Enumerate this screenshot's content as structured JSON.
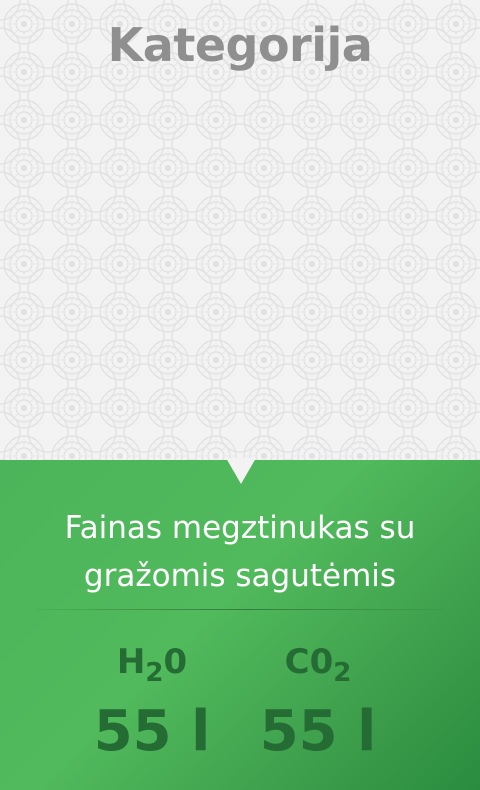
{
  "category": "Kategorija",
  "product": {
    "title_line1": "Fainas megztinukas su",
    "title_line2": "gražomis sagutėmis"
  },
  "stats": [
    {
      "label_main": "H",
      "label_sub": "2",
      "label_end": "0",
      "value": "55 l"
    },
    {
      "label_main": "C0",
      "label_sub": "2",
      "label_end": "",
      "value": "55 l"
    }
  ],
  "colors": {
    "accent_green": "#4cb45a",
    "dark_green": "#246b34",
    "pattern_bg": "#f3f3f3"
  }
}
